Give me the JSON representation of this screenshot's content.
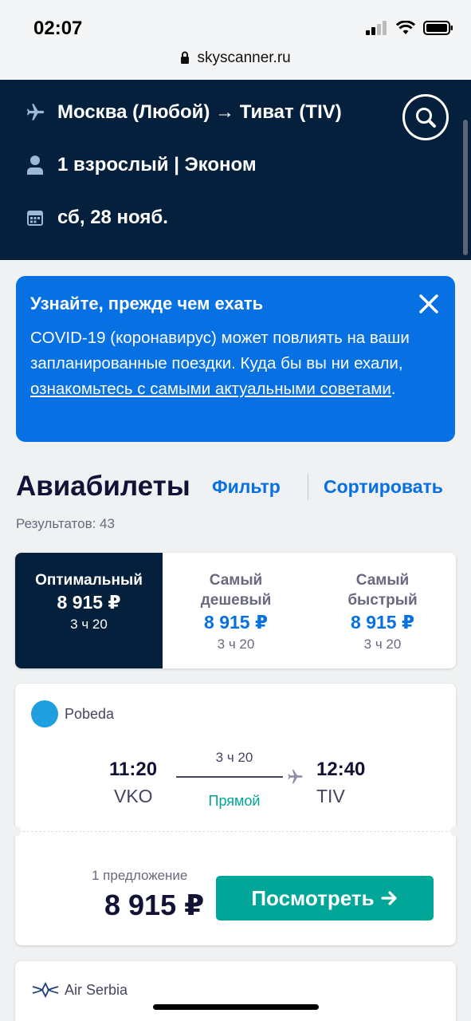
{
  "status": {
    "time": "02:07",
    "url": "skyscanner.ru"
  },
  "search": {
    "route": "Москва (Любой) → Тиват (TIV)",
    "passengers": "1 взрослый | Эконом",
    "date": "сб, 28 нояб."
  },
  "alert": {
    "title": "Узнайте, прежде чем ехать",
    "body": "COVID-19 (коронавирус) может повлиять на ваши запланированные поездки. Куда бы вы ни ехали, ",
    "link": "ознакомьтесь с самыми актуальными советами",
    "tail": "."
  },
  "results": {
    "title": "Авиабилеты",
    "filter": "Фильтр",
    "sort": "Сортировать",
    "count": "Результатов: 43"
  },
  "tabs": [
    {
      "label": "Оптимальный",
      "price": "8 915 ₽",
      "duration": "3 ч 20"
    },
    {
      "label": "Самый дешевый",
      "price": "8 915 ₽",
      "duration": "3 ч 20"
    },
    {
      "label": "Самый быстрый",
      "price": "8 915 ₽",
      "duration": "3 ч 20"
    }
  ],
  "flight": {
    "airline": "Pobeda",
    "dep_time": "11:20",
    "dep_code": "VKO",
    "arr_time": "12:40",
    "arr_code": "TIV",
    "duration": "3 ч 20",
    "stops": "Прямой",
    "offers": "1 предложение",
    "price": "8 915 ₽",
    "button": "Посмотреть"
  },
  "next_flight": {
    "airline": "Air Serbia"
  },
  "colors": {
    "header": "#05203c",
    "accent": "#0770e3",
    "cta": "#00a698"
  }
}
